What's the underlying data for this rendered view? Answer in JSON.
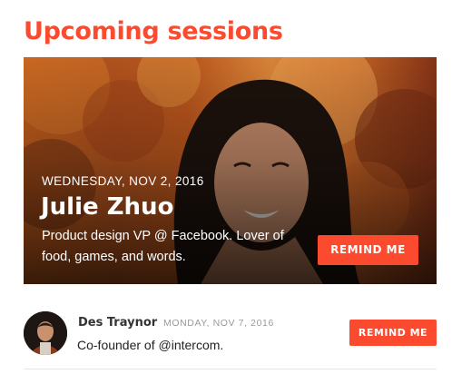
{
  "section": {
    "title": "Upcoming sessions"
  },
  "featured": {
    "date": "Wednesday, Nov 2, 2016",
    "name": "Julie Zhuo",
    "bio": "Product design VP @ Facebook. Lover of food, games, and words.",
    "button_label": "Remind me"
  },
  "sessions": [
    {
      "name": "Des Traynor",
      "date": "Monday, Nov 7, 2016",
      "bio": "Co-founder of @intercom.",
      "button_label": "Remind me"
    }
  ],
  "colors": {
    "accent": "#fb4a2d",
    "text_dark": "#222222",
    "text_muted": "#9a9a9a",
    "divider": "#e6e6e6"
  }
}
